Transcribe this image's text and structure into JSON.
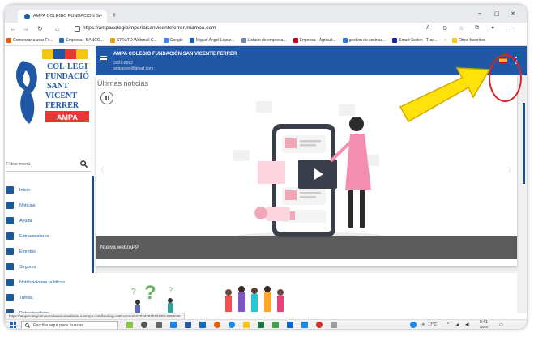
{
  "browser": {
    "tab_title": "AMPA COLEGIO FUNDACIÓN SA",
    "tab_close": "×",
    "new_tab": "+",
    "url": "https://ampacolegioimperialsanvicenteferrer.miampa.com",
    "window_minimize": "–",
    "window_maximize": "▢",
    "window_close": "✕",
    "bookmarks": [
      {
        "label": "Comenzar a usar Fir...",
        "color": "#e66000"
      },
      {
        "label": "Empresa - BANCO...",
        "color": "#1f6fbf"
      },
      {
        "label": "STRATO Webmail C...",
        "color": "#f39c12"
      },
      {
        "label": "Google",
        "color": "#4285f4"
      },
      {
        "label": "Miguel Angel López...",
        "color": "#0a66c2"
      },
      {
        "label": "Listado de empresa...",
        "color": "#6a8caf"
      },
      {
        "label": "Empresa - Agricult...",
        "color": "#d0021b"
      },
      {
        "label": "gestion de cocinas...",
        "color": "#2a7ae2"
      },
      {
        "label": "Smart Switch - Tran...",
        "color": "#1428a0"
      },
      {
        "label": "Otros favoritos",
        "color": "#f5c518"
      }
    ],
    "bookmark_more": "›"
  },
  "logo": {
    "lines": [
      "COL·LEGI",
      "FUNDACIÓ",
      "SANT",
      "VICENT",
      "FERRER"
    ],
    "badge": "AMPA"
  },
  "sidebar": {
    "filter_placeholder": "Filtrar menú",
    "items": [
      {
        "label": "Inicio",
        "icon": "home-icon"
      },
      {
        "label": "Noticias",
        "icon": "news-icon"
      },
      {
        "label": "Ayuda",
        "icon": "book-icon"
      },
      {
        "label": "Extraescolares",
        "icon": "running-icon"
      },
      {
        "label": "Eventos",
        "icon": "calendar-icon"
      },
      {
        "label": "Seguros",
        "icon": "plus-box-icon"
      },
      {
        "label": "Notificaciones públicas",
        "icon": "bell-box-icon"
      },
      {
        "label": "Tienda",
        "icon": "cart-icon"
      },
      {
        "label": "Patrocinadores",
        "icon": "briefcase-icon"
      }
    ]
  },
  "app": {
    "title": "AMPA COLEGIO FUNDACIÓN SAN VICENTE FERRER",
    "year": "2021-2022",
    "email": "ampacsvf@gmail.com",
    "accent": "#2058a6"
  },
  "news": {
    "heading": "Últimas noticias",
    "caption": "Nueva web/APP",
    "prev": "‹",
    "next": "›"
  },
  "status_url": "https://ampacolegioimperialsanvicenteferrer.miampa.com/landing-cat/custom/62763d782b3d10013659046",
  "taskbar": {
    "search_placeholder": "Escribe aquí para buscar",
    "weather": "17°C",
    "time": "9:41",
    "date": "28/04"
  }
}
